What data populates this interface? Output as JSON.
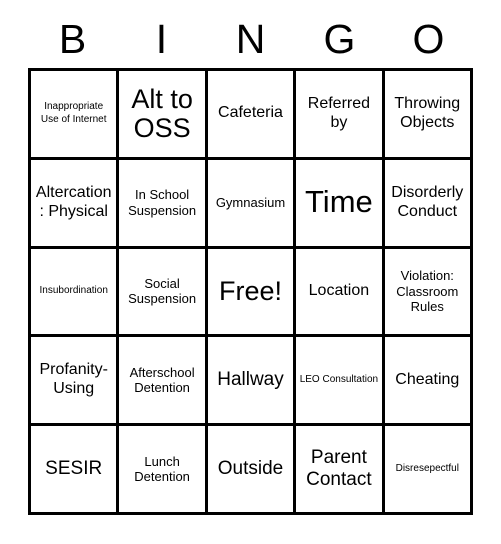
{
  "header": {
    "letters": [
      "B",
      "I",
      "N",
      "G",
      "O"
    ]
  },
  "colors": {
    "border": "#000000",
    "background": "#ffffff",
    "text": "#000000"
  },
  "grid": {
    "rows": 5,
    "columns": 5,
    "cells": [
      [
        {
          "text": "Inappropriate Use of Internet",
          "size": "xs"
        },
        {
          "text": "Alt to OSS",
          "size": "xl"
        },
        {
          "text": "Cafeteria",
          "size": "md"
        },
        {
          "text": "Referred by",
          "size": "md"
        },
        {
          "text": "Throwing Objects",
          "size": "md"
        }
      ],
      [
        {
          "text": "Altercation: Physical",
          "size": "md"
        },
        {
          "text": "In School Suspension",
          "size": "sm"
        },
        {
          "text": "Gymnasium",
          "size": "sm"
        },
        {
          "text": "Time",
          "size": "xxl"
        },
        {
          "text": "Disorderly Conduct",
          "size": "md"
        }
      ],
      [
        {
          "text": "Insubordination",
          "size": "xs"
        },
        {
          "text": "Social Suspension",
          "size": "sm"
        },
        {
          "text": "Free!",
          "size": "xl"
        },
        {
          "text": "Location",
          "size": "md"
        },
        {
          "text": "Violation: Classroom Rules",
          "size": "sm"
        }
      ],
      [
        {
          "text": "Profanity-Using",
          "size": "md"
        },
        {
          "text": "Afterschool Detention",
          "size": "sm"
        },
        {
          "text": "Hallway",
          "size": "lg"
        },
        {
          "text": "LEO Consultation",
          "size": "xs"
        },
        {
          "text": "Cheating",
          "size": "md"
        }
      ],
      [
        {
          "text": "SESIR",
          "size": "lg"
        },
        {
          "text": "Lunch Detention",
          "size": "sm"
        },
        {
          "text": "Outside",
          "size": "lg"
        },
        {
          "text": "Parent Contact",
          "size": "lg"
        },
        {
          "text": "Disresepectful",
          "size": "xs"
        }
      ]
    ]
  }
}
